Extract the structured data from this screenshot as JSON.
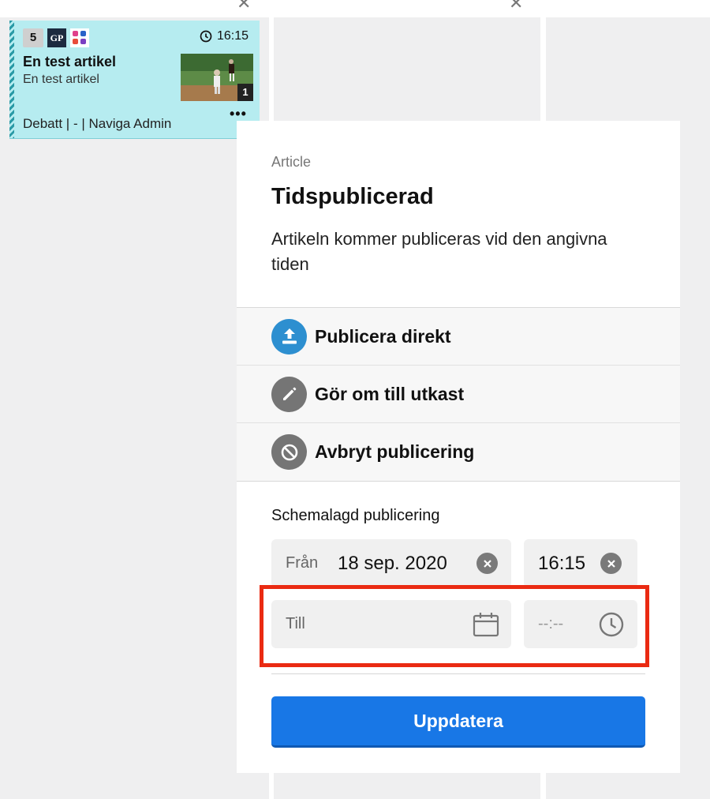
{
  "card": {
    "number": "5",
    "source_badge": "GP",
    "time": "16:15",
    "title": "En test artikel",
    "subtitle": "En test artikel",
    "image_count": "1",
    "meta": "Debatt | - | Naviga Admin",
    "more": "•••"
  },
  "popup": {
    "kicker": "Article",
    "title": "Tidspublicerad",
    "description": "Artikeln kommer publiceras vid den angivna tiden",
    "actions": [
      {
        "label": "Publicera direkt",
        "icon": "upload-icon",
        "color": "#2d8fd0"
      },
      {
        "label": "Gör om till utkast",
        "icon": "pencil-icon",
        "color": "#757575"
      },
      {
        "label": "Avbryt publicering",
        "icon": "block-icon",
        "color": "#757575"
      }
    ],
    "schedule": {
      "title": "Schemalagd publicering",
      "from_label": "Från",
      "from_date": "18 sep. 2020",
      "from_time": "16:15",
      "to_label": "Till",
      "to_time_placeholder": "--:--"
    },
    "update_button": "Uppdatera"
  },
  "colors": {
    "accent": "#1877e6",
    "highlight": "#ea2a12",
    "card_bg": "#b6ecf0"
  }
}
